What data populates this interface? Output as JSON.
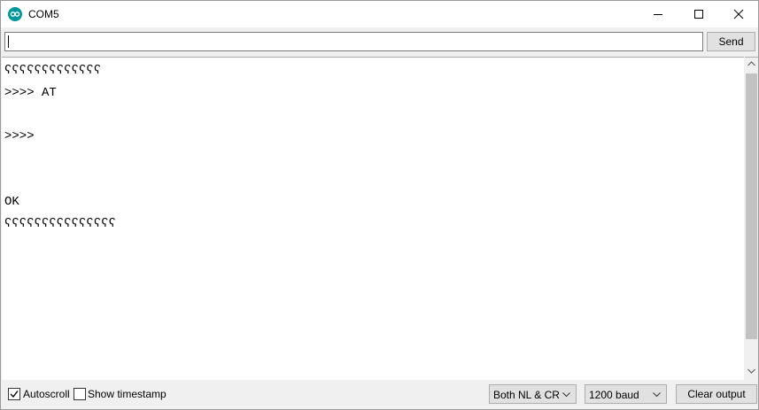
{
  "window": {
    "title": "COM5",
    "icon": "arduino-icon",
    "controls": [
      "minimize-icon",
      "maximize-icon",
      "close-icon"
    ]
  },
  "input": {
    "value": "",
    "send_label": "Send"
  },
  "output": {
    "lines": [
      "ʕʕʕʕʕʕʕʕʕʕʕʕʕ",
      ">>>> AT",
      "",
      ">>>>",
      "",
      "",
      "OK",
      "ʕʕʕʕʕʕʕʕʕʕʕʕʕʕʕ"
    ]
  },
  "footer": {
    "autoscroll_label": "Autoscroll",
    "autoscroll_checked": true,
    "timestamp_label": "Show timestamp",
    "timestamp_checked": false,
    "line_ending": "Both NL & CR",
    "baud_rate": "1200 baud",
    "clear_label": "Clear output"
  }
}
